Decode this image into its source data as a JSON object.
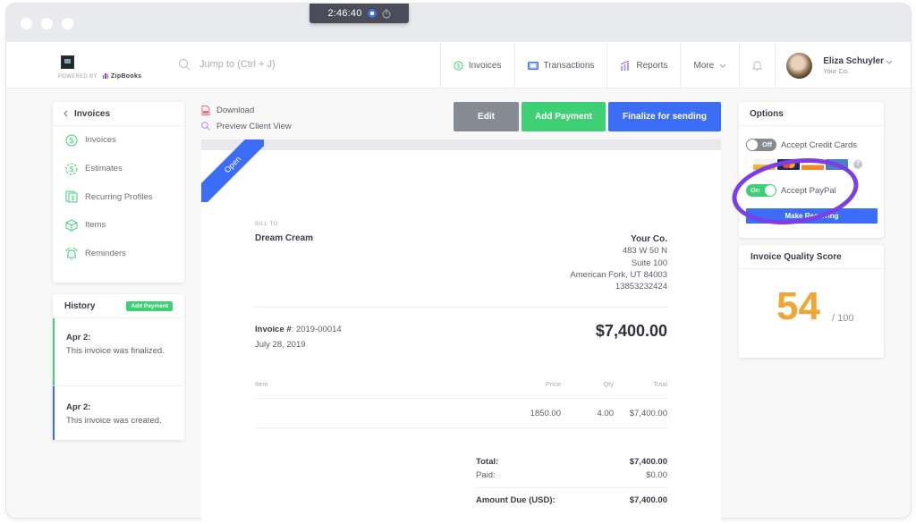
{
  "window": {
    "controls": [
      "close",
      "minimize",
      "maximize"
    ]
  },
  "header": {
    "powered_by": "POWERED BY",
    "brand": "ZipBooks",
    "search_placeholder": "Jump to (Ctrl + J)",
    "timer": {
      "time": "2:46:40",
      "stop_icon": "stop-icon",
      "stopwatch_icon": "stopwatch-icon"
    },
    "nav": [
      {
        "label": "Invoices",
        "icon": "dollar-circle-icon"
      },
      {
        "label": "Transactions",
        "icon": "money-card-icon"
      },
      {
        "label": "Reports",
        "icon": "chart-icon"
      },
      {
        "label": "More",
        "icon": "chevron-down-icon"
      }
    ],
    "bell_icon": "bell-icon",
    "user": {
      "name": "Eliza Schuyler",
      "company": "Your Co."
    }
  },
  "sidebar": {
    "back_label": "Invoices",
    "items": [
      {
        "label": "Invoices",
        "icon": "dollar-circle-icon"
      },
      {
        "label": "Estimates",
        "icon": "dollar-dashed-circle-icon"
      },
      {
        "label": "Recurring Profiles",
        "icon": "recurring-doc-icon"
      },
      {
        "label": "Items",
        "icon": "box-icon"
      },
      {
        "label": "Reminders",
        "icon": "alarm-icon"
      }
    ]
  },
  "history": {
    "title": "History",
    "add_payment": "Add Payment",
    "entries": [
      {
        "date": "Apr 2:",
        "text": "This invoice was finalized.",
        "color": "#3fcf74"
      },
      {
        "date": "Apr 2:",
        "text": "This invoice was created.",
        "color": "#3c6df6"
      }
    ]
  },
  "actions": {
    "download": "Download",
    "preview": "Preview Client View",
    "edit": "Edit",
    "add_payment": "Add Payment",
    "finalize": "Finalize for sending"
  },
  "invoice": {
    "status": "Open",
    "bill_to_label": "BILL TO",
    "bill_to_name": "Dream Cream",
    "from": {
      "company": "Your Co.",
      "address1": "483 W 50 N",
      "address2": "Suite 100",
      "city": "American Fork, UT 84003",
      "phone": "13853232424"
    },
    "number_label": "Invoice #",
    "number": ": 2019-00014",
    "date": "July 28, 2019",
    "amount": "$7,400.00",
    "columns": [
      "Item",
      "Price",
      "Qty",
      "Total"
    ],
    "lines": [
      {
        "item": "",
        "price": "1850.00",
        "qty": "4.00",
        "total": "$7,400.00"
      }
    ],
    "totals": {
      "total_label": "Total:",
      "total": "$7,400.00",
      "paid_label": "Paid:",
      "paid": "$0.00",
      "due_label": "Amount Due (USD):",
      "due": "$7,400.00"
    }
  },
  "options": {
    "title": "Options",
    "credit_cards": {
      "label": "Accept Credit Cards",
      "state": "Off"
    },
    "paypal": {
      "label": "Accept PayPal",
      "state": "On"
    },
    "make_button": "Make Recurring",
    "card_brands": [
      "visa",
      "mastercard",
      "discover",
      "amex"
    ]
  },
  "quality": {
    "title": "Invoice Quality Score",
    "score": "54",
    "max": "/ 100"
  },
  "colors": {
    "green": "#3fcf74",
    "blue": "#3c6df6",
    "gray": "#868a93",
    "orange": "#f3a533",
    "annotation": "#7b3fe4"
  }
}
